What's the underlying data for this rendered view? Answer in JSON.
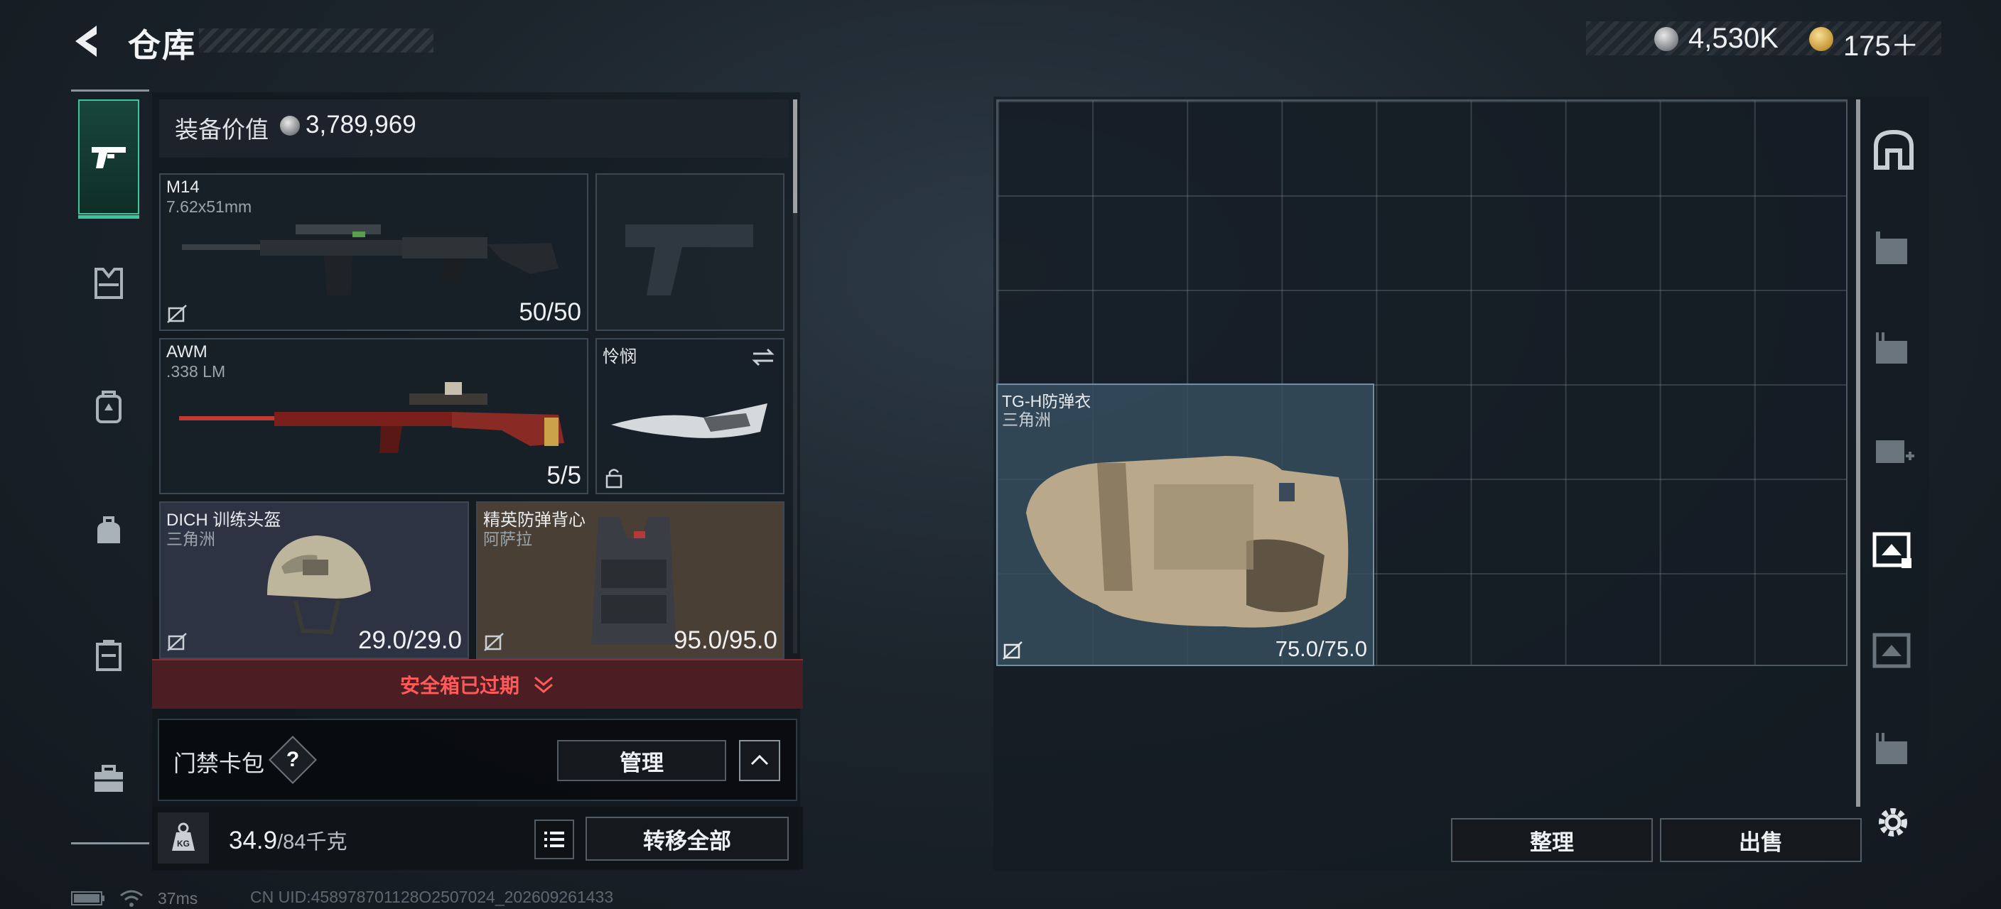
{
  "header": {
    "title": "仓库",
    "currency_silver": "4,530K",
    "currency_gold": "175＋"
  },
  "left_nav": {
    "items": [
      "weapon-icon",
      "armor-icon",
      "backpack-icon",
      "bag-icon",
      "container-icon",
      "toolbox-icon"
    ],
    "active": "weapon-icon"
  },
  "equipment": {
    "value_label": "装备价值",
    "value": "3,789,969",
    "slots": {
      "m14": {
        "name": "M14",
        "sub": "7.62x51mm",
        "count": "50/50"
      },
      "awm": {
        "name": "AWM",
        "sub": ".338 LM",
        "count": "5/5"
      },
      "knife": {
        "name": "怜悯"
      },
      "helmet": {
        "name": "DICH 训练头盔",
        "sub": "三角洲",
        "count": "29.0/29.0"
      },
      "vest": {
        "name": "精英防弹背心",
        "sub": "阿萨拉",
        "count": "95.0/95.0"
      }
    },
    "safe_box_status": "安全箱已过期",
    "card_bag": {
      "label": "门禁卡包",
      "help": "?",
      "manage_label": "管理"
    },
    "weight": {
      "current": "34.9",
      "max": "/84千克"
    },
    "transfer_all_label": "转移全部"
  },
  "storage": {
    "item": {
      "name": "TG-H防弹衣",
      "sub": "三角洲",
      "count": "75.0/75.0"
    },
    "sort_label": "整理",
    "sell_label": "出售"
  },
  "right_rail": {
    "items": [
      "safe-icon",
      "storage-tab-1-icon",
      "storage-tab-2-icon",
      "storage-tab-3-icon",
      "storage-tab-4-icon",
      "storage-tab-5-icon",
      "storage-tab-6-icon",
      "settings-icon"
    ],
    "active": "storage-tab-4-icon"
  },
  "status_bar": {
    "ping": "37ms",
    "uid": "CN UID:458978701128O2507024_202609261433"
  },
  "colors": {
    "accent": "#3ac89a",
    "danger": "#ff5a5a",
    "helmet_bg": "#2d3342",
    "vest_bg": "#4a3f35",
    "grid_item_bg": "#364e5e"
  }
}
